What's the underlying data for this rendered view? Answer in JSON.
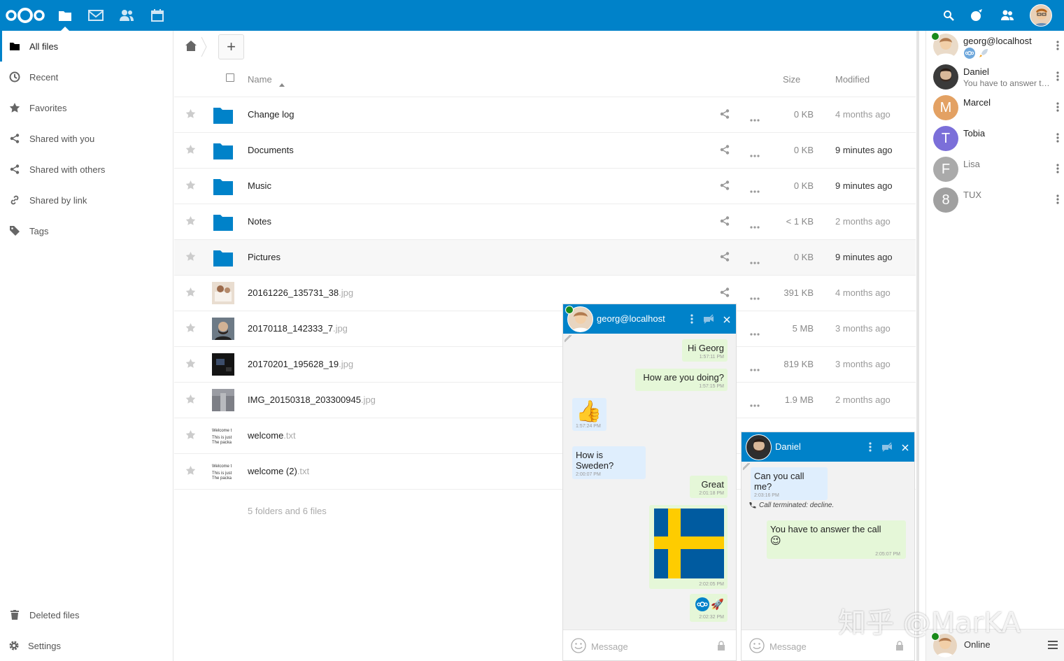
{
  "sidebar": {
    "items": [
      {
        "label": "All files",
        "icon": "folder-icon"
      },
      {
        "label": "Recent",
        "icon": "clock-icon"
      },
      {
        "label": "Favorites",
        "icon": "star-icon"
      },
      {
        "label": "Shared with you",
        "icon": "share-icon"
      },
      {
        "label": "Shared with others",
        "icon": "share-icon"
      },
      {
        "label": "Shared by link",
        "icon": "link-icon"
      },
      {
        "label": "Tags",
        "icon": "tag-icon"
      }
    ],
    "deleted": "Deleted files",
    "settings": "Settings"
  },
  "files": {
    "add_label": "+",
    "header": {
      "name": "Name",
      "size": "Size",
      "modified": "Modified"
    },
    "rows": [
      {
        "name": "Change log",
        "ext": "",
        "size": "0 KB",
        "modified": "4 months ago",
        "recent": false,
        "type": "folder"
      },
      {
        "name": "Documents",
        "ext": "",
        "size": "0 KB",
        "modified": "9 minutes ago",
        "recent": true,
        "type": "folder"
      },
      {
        "name": "Music",
        "ext": "",
        "size": "0 KB",
        "modified": "9 minutes ago",
        "recent": true,
        "type": "folder"
      },
      {
        "name": "Notes",
        "ext": "",
        "size": "< 1 KB",
        "modified": "2 months ago",
        "recent": false,
        "type": "folder"
      },
      {
        "name": "Pictures",
        "ext": "",
        "size": "0 KB",
        "modified": "9 minutes ago",
        "recent": true,
        "type": "folder"
      },
      {
        "name": "20161226_135731_38",
        "ext": ".jpg",
        "size": "391 KB",
        "modified": "4 months ago",
        "recent": false,
        "type": "image"
      },
      {
        "name": "20170118_142333_7",
        "ext": ".jpg",
        "size": "5 MB",
        "modified": "3 months ago",
        "recent": false,
        "type": "image"
      },
      {
        "name": "20170201_195628_19",
        "ext": ".jpg",
        "size": "819 KB",
        "modified": "3 months ago",
        "recent": false,
        "type": "image"
      },
      {
        "name": "IMG_20150318_203300945",
        "ext": ".jpg",
        "size": "1.9 MB",
        "modified": "2 months ago",
        "recent": false,
        "type": "image"
      },
      {
        "name": "welcome",
        "ext": ".txt",
        "size": "",
        "modified": "",
        "recent": false,
        "type": "text"
      },
      {
        "name": "welcome (2)",
        "ext": ".txt",
        "size": "",
        "modified": "",
        "recent": false,
        "type": "text"
      }
    ],
    "summary": "5 folders and 6 files",
    "thumb_text": [
      "Welcome t",
      "This is just",
      "The packa"
    ]
  },
  "contacts": [
    {
      "name": "georg@localhost",
      "status": "",
      "initial": "",
      "color": "#c9a27a",
      "online": true
    },
    {
      "name": "Daniel",
      "status": "You have to answer the call",
      "initial": "",
      "color": "#3a3a3a",
      "online": false
    },
    {
      "name": "Marcel",
      "status": "",
      "initial": "M",
      "color": "#e3a163",
      "online": false
    },
    {
      "name": "Tobia",
      "status": "",
      "initial": "T",
      "color": "#7b6fd9",
      "online": false
    },
    {
      "name": "Lisa",
      "status": "",
      "initial": "F",
      "color": "#aaaaaa",
      "online": false
    },
    {
      "name": "TUX",
      "status": "",
      "initial": "8",
      "color": "#a0a0a0",
      "online": false
    }
  ],
  "presence": {
    "label": "Online"
  },
  "chat1": {
    "title": "georg@localhost",
    "messages": [
      {
        "text": "Hi Georg",
        "time": "1:57:11 PM",
        "me": true
      },
      {
        "text": "How are you doing?",
        "time": "1:57:15 PM",
        "me": true
      },
      {
        "text": "👍",
        "time": "1:57:24 PM",
        "me": false
      },
      {
        "text": "How is Sweden?",
        "time": "2:00:07 PM",
        "me": false
      },
      {
        "text": "Great",
        "time": "2:01:18 PM",
        "me": true
      },
      {
        "text": "",
        "time": "2:02:05 PM",
        "me": true
      },
      {
        "text": "🚀",
        "time": "2:02:32 PM",
        "me": true
      }
    ],
    "placeholder": "Message"
  },
  "chat2": {
    "title": "Daniel",
    "messages": [
      {
        "text": "Can you call me?",
        "time": "2:03:16 PM",
        "me": false
      },
      {
        "text": "You have to answer the call",
        "emoji": "😉",
        "time": "2:05:07 PM",
        "me": true
      }
    ],
    "system": "Call terminated: decline.",
    "placeholder": "Message"
  },
  "watermark": "知乎 @MarKA",
  "colors": {
    "brand": "#0082c9",
    "folder": "#0082c9",
    "online": "#1a8a1a",
    "flag_blue": "#005ba0",
    "flag_yellow": "#fecc00"
  }
}
